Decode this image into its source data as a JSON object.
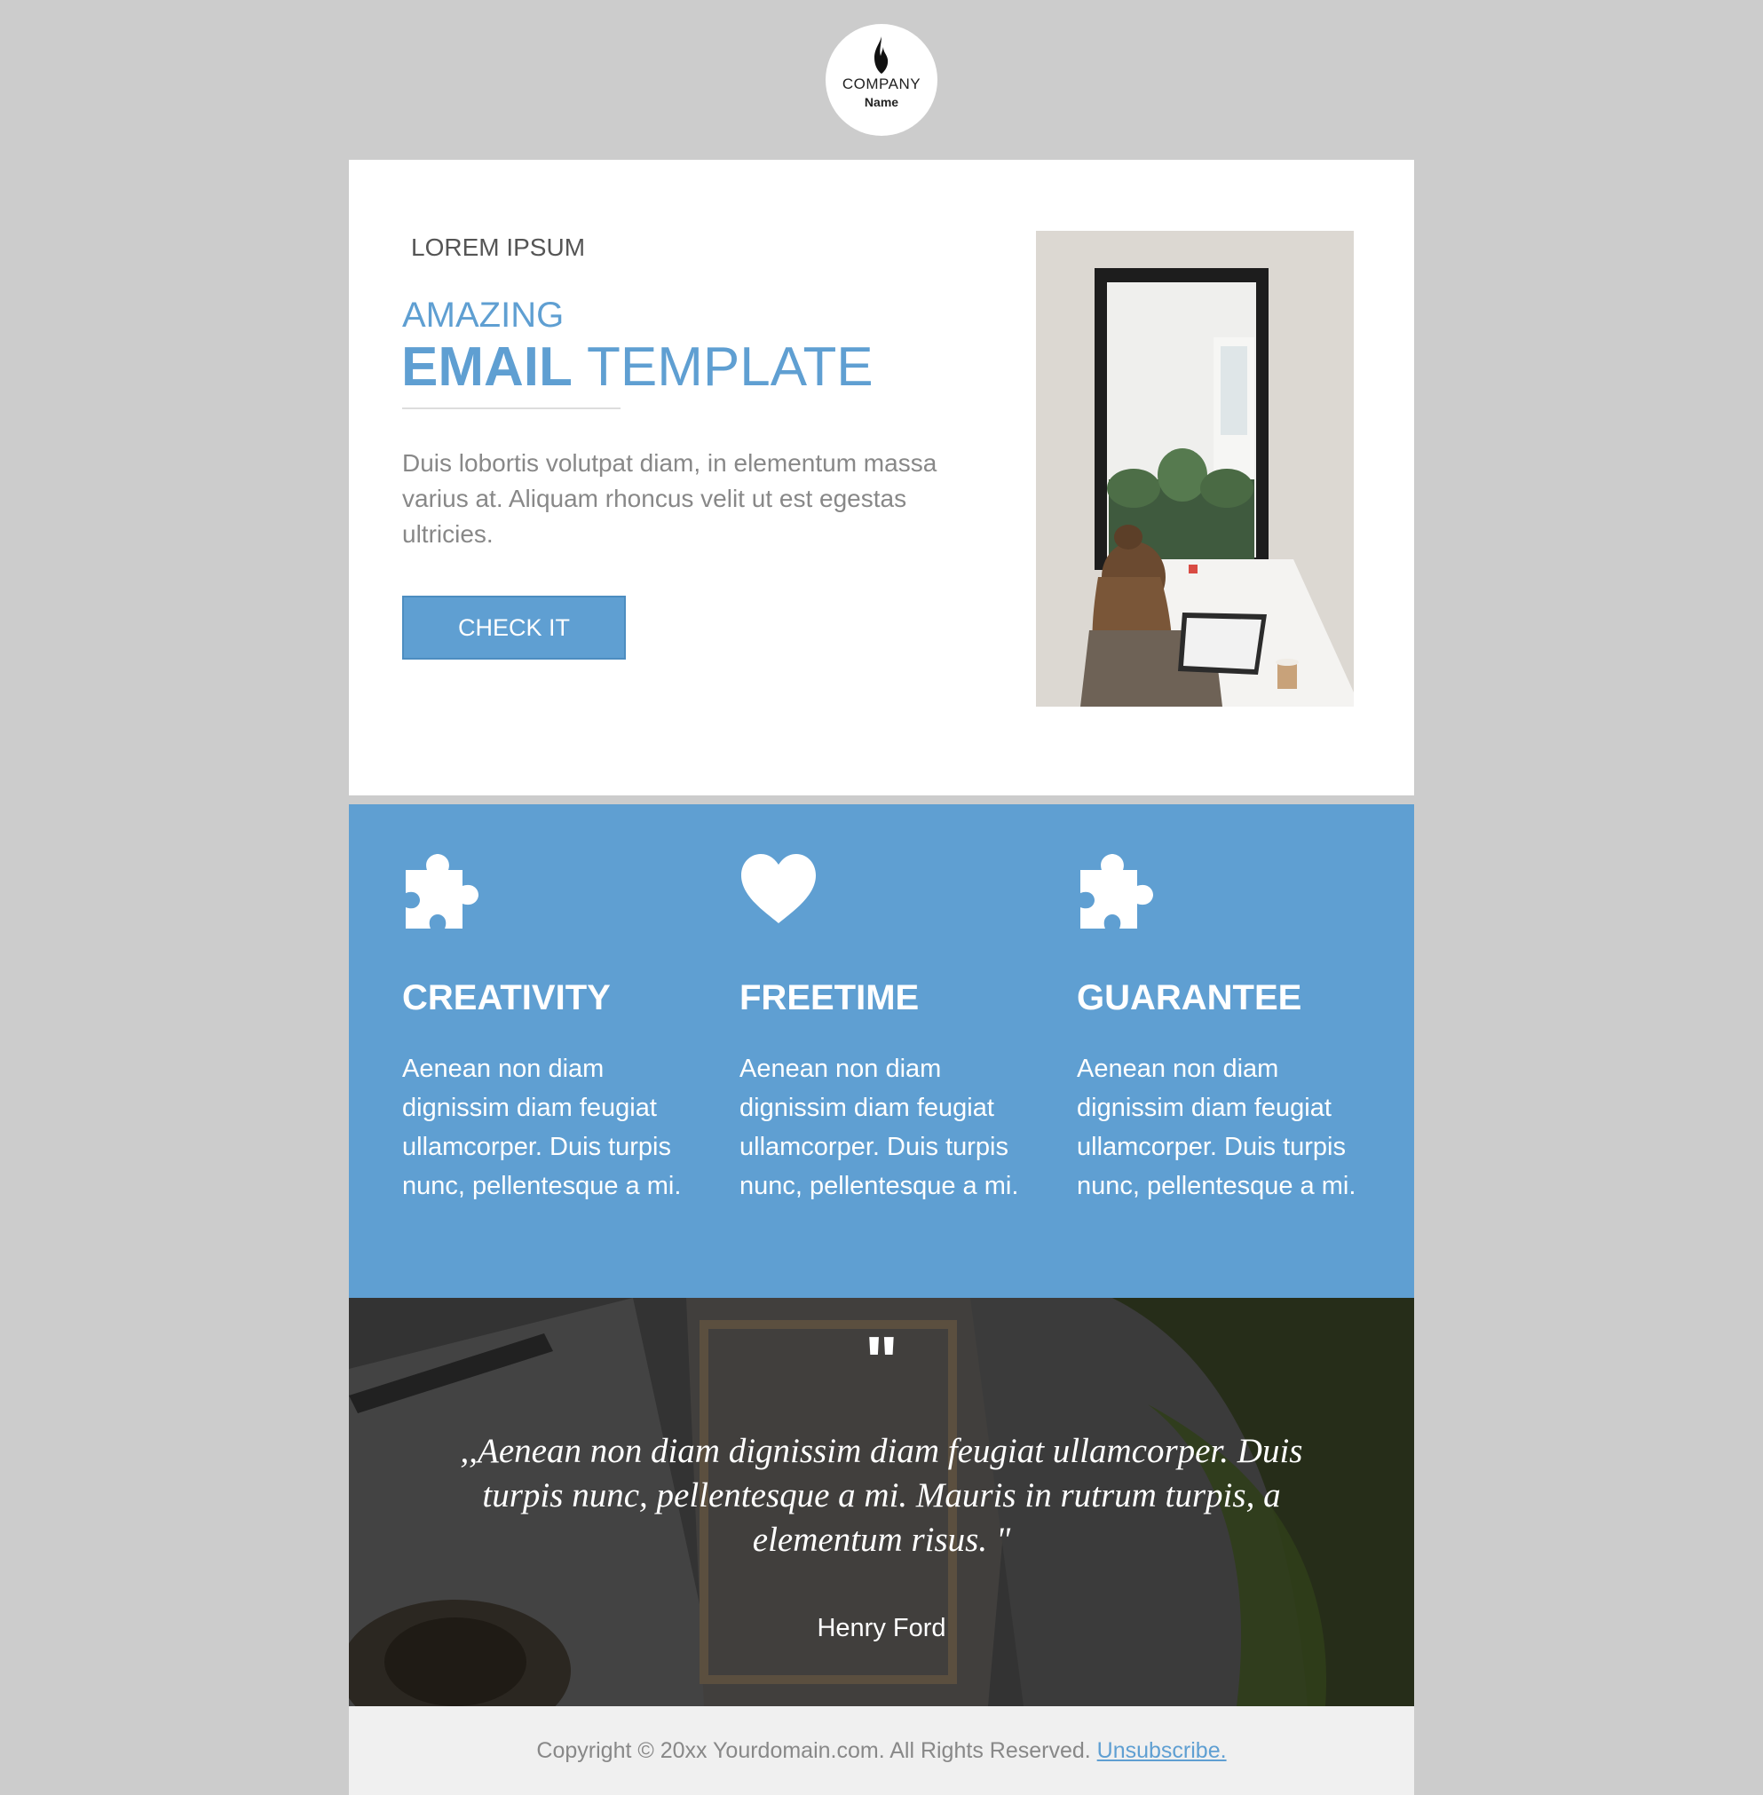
{
  "logo": {
    "line1": "COMPANY",
    "line2": "Name",
    "icon": "flame-icon"
  },
  "hero": {
    "kicker": "LOREM IPSUM",
    "title_small": "AMAZING",
    "title_bold": "EMAIL",
    "title_rest": " TEMPLATE",
    "body": "Duis lobortis volutpat diam, in elementum massa varius at. Aliquam rhoncus velit ut est egestas ultricies.",
    "cta_label": "CHECK IT"
  },
  "features": [
    {
      "icon": "puzzle-icon",
      "title": "CREATIVITY",
      "text": "Aenean non diam dignissim diam feugiat ullamcorper. Duis turpis nunc, pellentesque a mi."
    },
    {
      "icon": "heart-icon",
      "title": "FREETIME",
      "text": "Aenean non diam dignissim diam feugiat ullamcorper. Duis turpis nunc, pellentesque a mi."
    },
    {
      "icon": "puzzle-icon",
      "title": "GUARANTEE",
      "text": "Aenean non diam dignissim diam feugiat ullamcorper. Duis turpis nunc, pellentesque a mi."
    }
  ],
  "quote": {
    "mark": "\"",
    "text": ",,Aenean non diam dignissim diam feugiat ullamcorper. Duis turpis nunc, pellentesque a mi. Mauris in rutrum turpis, a elementum risus. \"",
    "author": "Henry Ford"
  },
  "footer": {
    "copyright": "Copyright © 20xx Yourdomain.com. All Rights Reserved. ",
    "unsubscribe": "Unsubscribe."
  },
  "colors": {
    "accent": "#5f9fd2",
    "background": "#cccccc",
    "footer_bg": "#f0f0f0"
  }
}
